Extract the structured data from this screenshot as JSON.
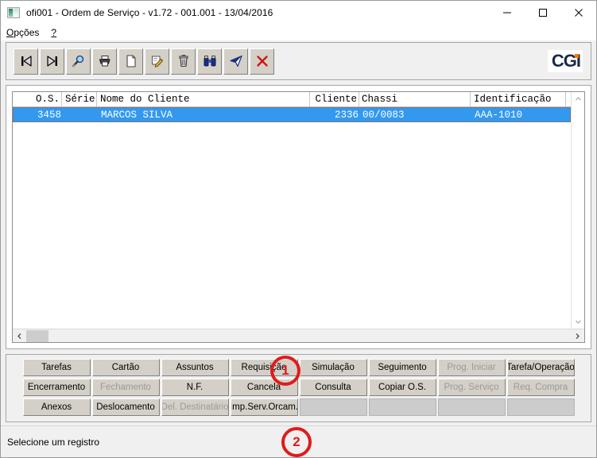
{
  "window": {
    "title": "ofi001 - Ordem de Serviço - v1.72 - 001.001 - 13/04/2016",
    "app_icon": "window-icon",
    "controls": {
      "minimize": "minimize-icon",
      "maximize": "maximize-icon",
      "close": "close-icon"
    }
  },
  "menubar": {
    "items": [
      {
        "label": "Opções",
        "accel": "O"
      },
      {
        "label": "?",
        "accel": "?"
      }
    ]
  },
  "toolbar": {
    "buttons": [
      {
        "name": "first-record-icon",
        "tip": "Primeiro"
      },
      {
        "name": "last-record-icon",
        "tip": "Último"
      },
      {
        "name": "magnifier-icon",
        "tip": "Pesquisar"
      },
      {
        "name": "printer-icon",
        "tip": "Imprimir"
      },
      {
        "name": "new-document-icon",
        "tip": "Novo"
      },
      {
        "name": "edit-pencil-icon",
        "tip": "Editar"
      },
      {
        "name": "trash-icon",
        "tip": "Excluir"
      },
      {
        "name": "binoculars-icon",
        "tip": "Localizar"
      },
      {
        "name": "send-icon",
        "tip": "Enviar"
      },
      {
        "name": "cancel-x-icon",
        "tip": "Cancelar"
      }
    ],
    "logo": {
      "text": "CGI",
      "color": "#1b2a4a",
      "accent": "#f07d00"
    }
  },
  "grid": {
    "columns": [
      {
        "key": "os",
        "label": "O.S."
      },
      {
        "key": "serie",
        "label": "Série"
      },
      {
        "key": "nome",
        "label": "Nome do Cliente"
      },
      {
        "key": "cliente",
        "label": "Cliente"
      },
      {
        "key": "chassi",
        "label": "Chassi"
      },
      {
        "key": "identificacao",
        "label": "Identificação"
      }
    ],
    "rows": [
      {
        "os": "3458",
        "serie": "",
        "nome": "MARCOS SILVA",
        "cliente": "2336",
        "chassi": "00/0083",
        "identificacao": "AAA-1010",
        "selected": true
      }
    ],
    "selection_color": "#3399ee",
    "scrollbars": {
      "vertical": {
        "up": "chevron-up-icon",
        "down": "chevron-down-icon"
      },
      "horizontal": {
        "left": "chevron-left-icon",
        "right": "chevron-right-icon"
      }
    }
  },
  "buttons": {
    "row1": [
      {
        "label": "Tarefas",
        "disabled": false
      },
      {
        "label": "Cartão",
        "disabled": false
      },
      {
        "label": "Assuntos",
        "disabled": false
      },
      {
        "label": "Requisição",
        "disabled": false
      },
      {
        "label": "Simulação",
        "disabled": false
      },
      {
        "label": "Seguimento",
        "disabled": false
      },
      {
        "label": "Prog. Iniciar",
        "disabled": true
      },
      {
        "label": "Tarefa/Operação",
        "disabled": false
      }
    ],
    "row2": [
      {
        "label": "Encerramento",
        "disabled": false
      },
      {
        "label": "Fechamento",
        "disabled": true
      },
      {
        "label": "N.F.",
        "disabled": false
      },
      {
        "label": "Cancela",
        "disabled": false
      },
      {
        "label": "Consulta",
        "disabled": false
      },
      {
        "label": "Copiar O.S.",
        "disabled": false
      },
      {
        "label": "Prog. Serviço",
        "disabled": true
      },
      {
        "label": "Req. Compra",
        "disabled": true
      }
    ],
    "row3": [
      {
        "label": "Anexos",
        "disabled": false
      },
      {
        "label": "Deslocamento",
        "disabled": false
      },
      {
        "label": "Del. Destinatário",
        "disabled": true
      },
      {
        "label": "Imp.Serv.Orcam.",
        "disabled": false
      },
      {
        "label": "",
        "blank": true
      },
      {
        "label": "",
        "blank": true
      },
      {
        "label": "",
        "blank": true
      },
      {
        "label": "",
        "blank": true
      }
    ]
  },
  "statusbar": {
    "text": "Selecione um registro"
  },
  "annotations": [
    {
      "number": "1",
      "color": "#e01b1b",
      "target": "Requisição"
    },
    {
      "number": "2",
      "color": "#e01b1b",
      "target": "Imp.Serv.Orcam."
    }
  ]
}
